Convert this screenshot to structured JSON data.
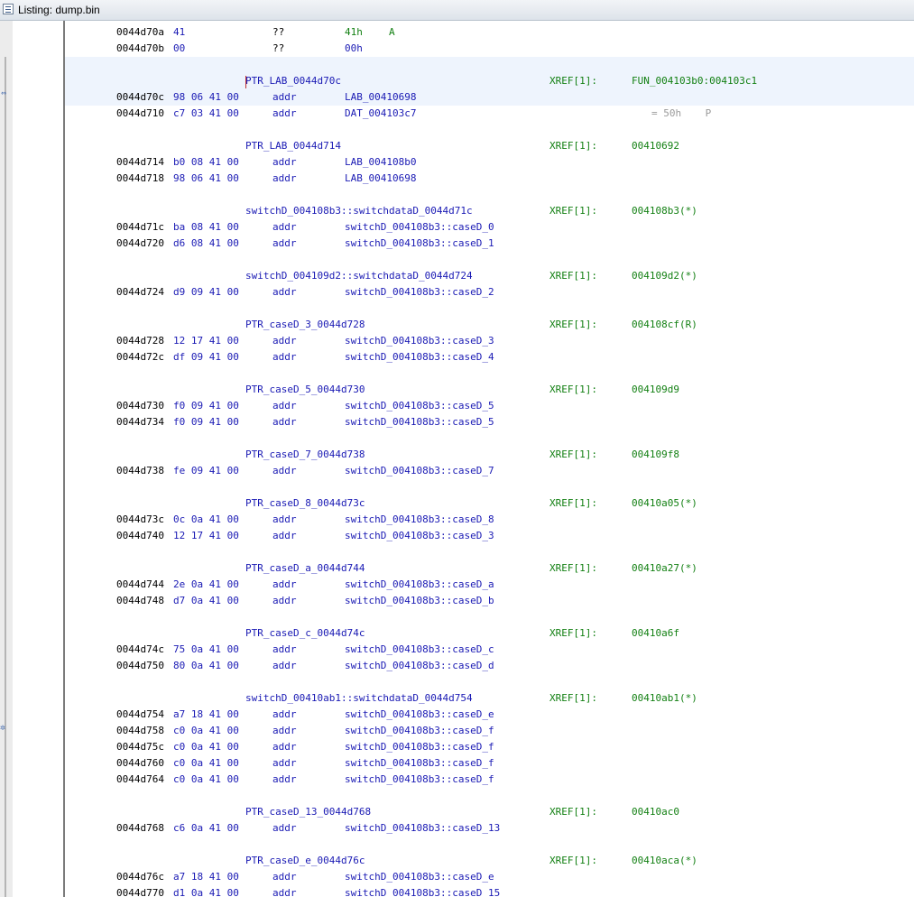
{
  "window": {
    "title": "Listing:  dump.bin"
  },
  "rows": [
    {
      "kind": "data",
      "addr": "0044d70a",
      "bytes": "41",
      "mnem": "??",
      "oper": "41h",
      "ch": "A"
    },
    {
      "kind": "data",
      "addr": "0044d70b",
      "bytes": "00",
      "mnem": "??",
      "oper": "00h"
    },
    {
      "kind": "blank"
    },
    {
      "kind": "label",
      "label": "PTR_LAB_0044d70c",
      "xref": "XREF[1]:",
      "xval": "FUN_004103b0:004103c1"
    },
    {
      "kind": "data",
      "addr": "0044d70c",
      "bytes": "98 06 41 00",
      "mnem": "addr",
      "oper": "LAB_00410698"
    },
    {
      "kind": "data",
      "addr": "0044d710",
      "bytes": "c7 03 41 00",
      "mnem": "addr",
      "oper": "DAT_004103c7",
      "cmt": "= 50h    P"
    },
    {
      "kind": "blank"
    },
    {
      "kind": "label",
      "label": "PTR_LAB_0044d714",
      "xref": "XREF[1]:",
      "xval": "00410692"
    },
    {
      "kind": "data",
      "addr": "0044d714",
      "bytes": "b0 08 41 00",
      "mnem": "addr",
      "oper": "LAB_004108b0"
    },
    {
      "kind": "data",
      "addr": "0044d718",
      "bytes": "98 06 41 00",
      "mnem": "addr",
      "oper": "LAB_00410698"
    },
    {
      "kind": "blank"
    },
    {
      "kind": "label",
      "label": "switchD_004108b3::switchdataD_0044d71c",
      "xref": "XREF[1]:",
      "xval": "004108b3(*)"
    },
    {
      "kind": "data",
      "addr": "0044d71c",
      "bytes": "ba 08 41 00",
      "mnem": "addr",
      "oper": "switchD_004108b3::caseD_0"
    },
    {
      "kind": "data",
      "addr": "0044d720",
      "bytes": "d6 08 41 00",
      "mnem": "addr",
      "oper": "switchD_004108b3::caseD_1"
    },
    {
      "kind": "blank"
    },
    {
      "kind": "label",
      "label": "switchD_004109d2::switchdataD_0044d724",
      "xref": "XREF[1]:",
      "xval": "004109d2(*)"
    },
    {
      "kind": "data",
      "addr": "0044d724",
      "bytes": "d9 09 41 00",
      "mnem": "addr",
      "oper": "switchD_004108b3::caseD_2"
    },
    {
      "kind": "blank"
    },
    {
      "kind": "label",
      "label": "PTR_caseD_3_0044d728",
      "xref": "XREF[1]:",
      "xval": "004108cf(R)"
    },
    {
      "kind": "data",
      "addr": "0044d728",
      "bytes": "12 17 41 00",
      "mnem": "addr",
      "oper": "switchD_004108b3::caseD_3"
    },
    {
      "kind": "data",
      "addr": "0044d72c",
      "bytes": "df 09 41 00",
      "mnem": "addr",
      "oper": "switchD_004108b3::caseD_4"
    },
    {
      "kind": "blank"
    },
    {
      "kind": "label",
      "label": "PTR_caseD_5_0044d730",
      "xref": "XREF[1]:",
      "xval": "004109d9"
    },
    {
      "kind": "data",
      "addr": "0044d730",
      "bytes": "f0 09 41 00",
      "mnem": "addr",
      "oper": "switchD_004108b3::caseD_5"
    },
    {
      "kind": "data",
      "addr": "0044d734",
      "bytes": "f0 09 41 00",
      "mnem": "addr",
      "oper": "switchD_004108b3::caseD_5"
    },
    {
      "kind": "blank"
    },
    {
      "kind": "label",
      "label": "PTR_caseD_7_0044d738",
      "xref": "XREF[1]:",
      "xval": "004109f8"
    },
    {
      "kind": "data",
      "addr": "0044d738",
      "bytes": "fe 09 41 00",
      "mnem": "addr",
      "oper": "switchD_004108b3::caseD_7"
    },
    {
      "kind": "blank"
    },
    {
      "kind": "label",
      "label": "PTR_caseD_8_0044d73c",
      "xref": "XREF[1]:",
      "xval": "00410a05(*)"
    },
    {
      "kind": "data",
      "addr": "0044d73c",
      "bytes": "0c 0a 41 00",
      "mnem": "addr",
      "oper": "switchD_004108b3::caseD_8"
    },
    {
      "kind": "data",
      "addr": "0044d740",
      "bytes": "12 17 41 00",
      "mnem": "addr",
      "oper": "switchD_004108b3::caseD_3"
    },
    {
      "kind": "blank"
    },
    {
      "kind": "label",
      "label": "PTR_caseD_a_0044d744",
      "xref": "XREF[1]:",
      "xval": "00410a27(*)"
    },
    {
      "kind": "data",
      "addr": "0044d744",
      "bytes": "2e 0a 41 00",
      "mnem": "addr",
      "oper": "switchD_004108b3::caseD_a"
    },
    {
      "kind": "data",
      "addr": "0044d748",
      "bytes": "d7 0a 41 00",
      "mnem": "addr",
      "oper": "switchD_004108b3::caseD_b"
    },
    {
      "kind": "blank"
    },
    {
      "kind": "label",
      "label": "PTR_caseD_c_0044d74c",
      "xref": "XREF[1]:",
      "xval": "00410a6f"
    },
    {
      "kind": "data",
      "addr": "0044d74c",
      "bytes": "75 0a 41 00",
      "mnem": "addr",
      "oper": "switchD_004108b3::caseD_c"
    },
    {
      "kind": "data",
      "addr": "0044d750",
      "bytes": "80 0a 41 00",
      "mnem": "addr",
      "oper": "switchD_004108b3::caseD_d"
    },
    {
      "kind": "blank"
    },
    {
      "kind": "label",
      "label": "switchD_00410ab1::switchdataD_0044d754",
      "xref": "XREF[1]:",
      "xval": "00410ab1(*)"
    },
    {
      "kind": "data",
      "addr": "0044d754",
      "bytes": "a7 18 41 00",
      "mnem": "addr",
      "oper": "switchD_004108b3::caseD_e"
    },
    {
      "kind": "data",
      "addr": "0044d758",
      "bytes": "c0 0a 41 00",
      "mnem": "addr",
      "oper": "switchD_004108b3::caseD_f"
    },
    {
      "kind": "data",
      "addr": "0044d75c",
      "bytes": "c0 0a 41 00",
      "mnem": "addr",
      "oper": "switchD_004108b3::caseD_f"
    },
    {
      "kind": "data",
      "addr": "0044d760",
      "bytes": "c0 0a 41 00",
      "mnem": "addr",
      "oper": "switchD_004108b3::caseD_f"
    },
    {
      "kind": "data",
      "addr": "0044d764",
      "bytes": "c0 0a 41 00",
      "mnem": "addr",
      "oper": "switchD_004108b3::caseD_f"
    },
    {
      "kind": "blank"
    },
    {
      "kind": "label",
      "label": "PTR_caseD_13_0044d768",
      "xref": "XREF[1]:",
      "xval": "00410ac0"
    },
    {
      "kind": "data",
      "addr": "0044d768",
      "bytes": "c6 0a 41 00",
      "mnem": "addr",
      "oper": "switchD_004108b3::caseD_13"
    },
    {
      "kind": "blank"
    },
    {
      "kind": "label",
      "label": "PTR_caseD_e_0044d76c",
      "xref": "XREF[1]:",
      "xval": "00410aca(*)"
    },
    {
      "kind": "data",
      "addr": "0044d76c",
      "bytes": "a7 18 41 00",
      "mnem": "addr",
      "oper": "switchD_004108b3::caseD_e"
    },
    {
      "kind": "data",
      "addr": "0044d770",
      "bytes": "d1 0a 41 00",
      "mnem": "addr",
      "oper": "switchD_004108b3::caseD_15"
    }
  ]
}
